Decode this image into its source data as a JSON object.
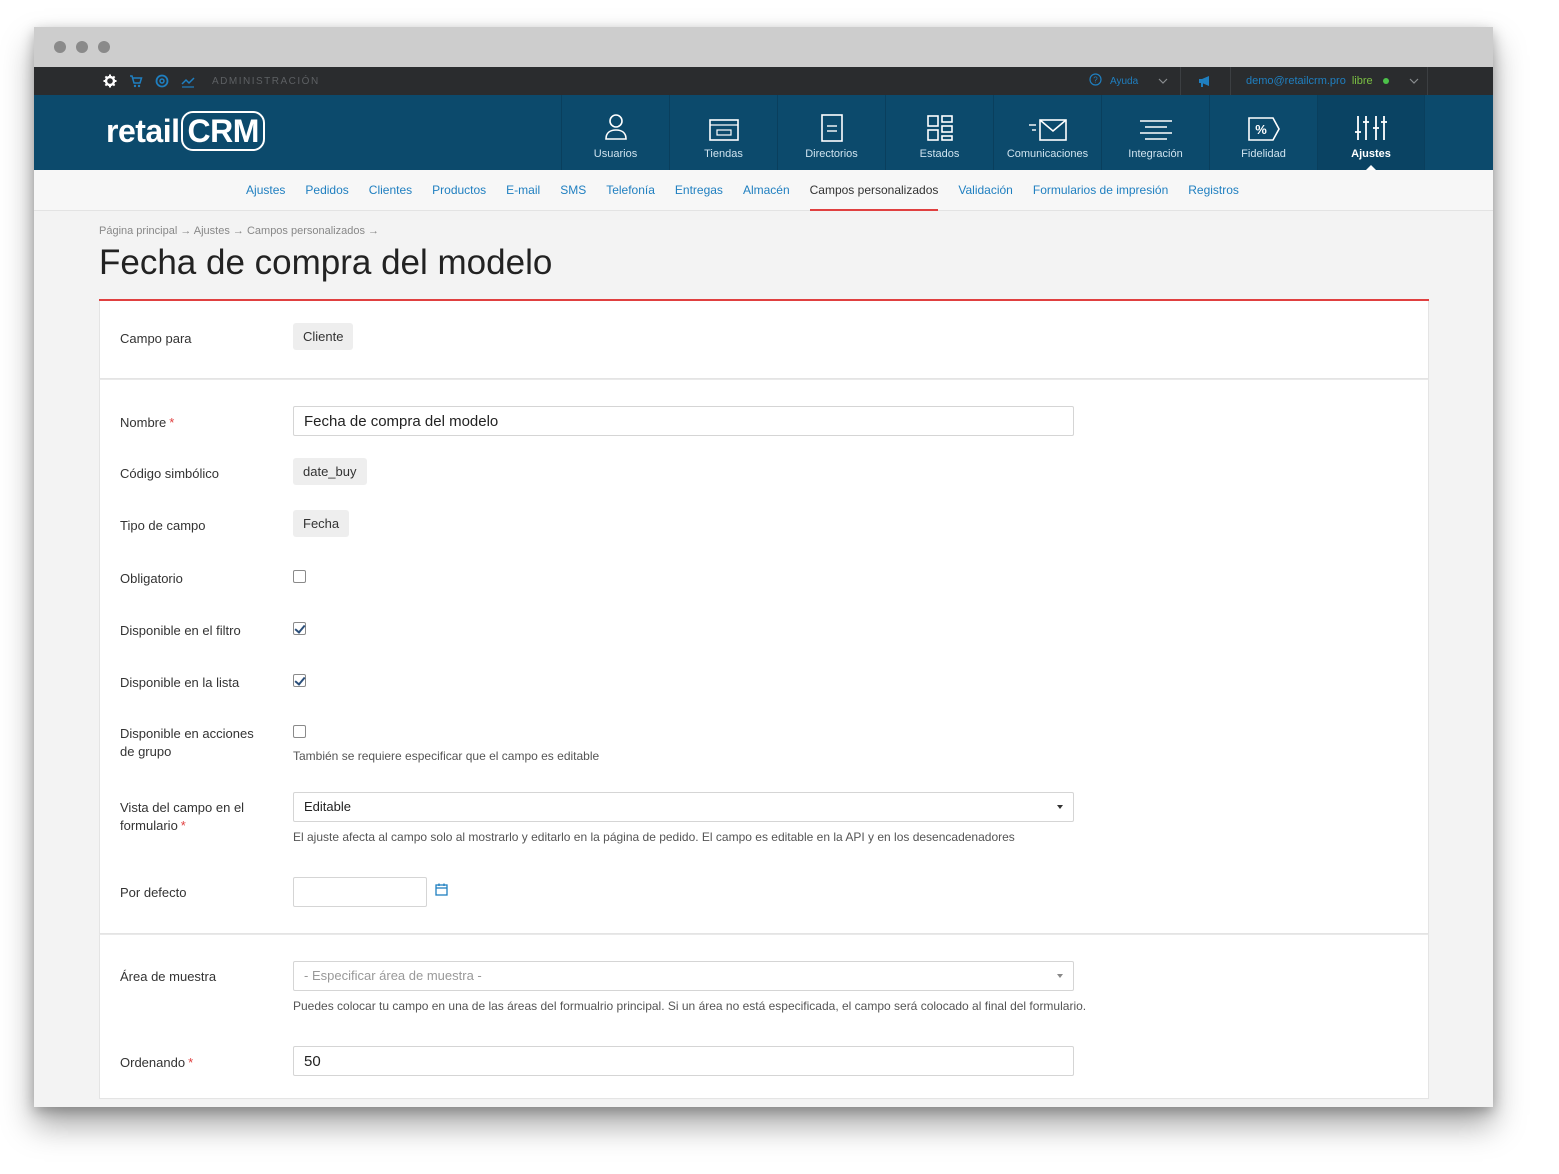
{
  "adminbar": {
    "admin_label": "ADMINISTRACIÓN",
    "help_label": "Ayuda",
    "user_email": "demo@retailcrm.pro",
    "user_plan": "libre"
  },
  "brand": {
    "name_prefix": "retail",
    "name_suffix": "CRM"
  },
  "nav": {
    "items": [
      {
        "label": "Usuarios",
        "icon": "user-icon"
      },
      {
        "label": "Tiendas",
        "icon": "store-icon"
      },
      {
        "label": "Directorios",
        "icon": "directory-icon"
      },
      {
        "label": "Estados",
        "icon": "statuses-icon"
      },
      {
        "label": "Comunicaciones",
        "icon": "mail-icon"
      },
      {
        "label": "Integración",
        "icon": "integration-icon"
      },
      {
        "label": "Fidelidad",
        "icon": "loyalty-icon"
      },
      {
        "label": "Ajustes",
        "icon": "settings-sliders-icon"
      }
    ],
    "active": "Ajustes"
  },
  "subnav": {
    "items": [
      "Ajustes",
      "Pedidos",
      "Clientes",
      "Productos",
      "E-mail",
      "SMS",
      "Telefonía",
      "Entregas",
      "Almacén",
      "Campos personalizados",
      "Validación",
      "Formularios de impresión",
      "Registros"
    ],
    "active": "Campos personalizados"
  },
  "breadcrumb": "Página principal → Ajustes → Campos personalizados →",
  "page_title": "Fecha de compra del modelo",
  "form": {
    "campo_para": {
      "label": "Campo para",
      "value": "Cliente"
    },
    "nombre": {
      "label": "Nombre",
      "value": "Fecha de compra del modelo"
    },
    "codigo": {
      "label": "Código simbólico",
      "value": "date_buy"
    },
    "tipo": {
      "label": "Tipo de campo",
      "value": "Fecha"
    },
    "obligatorio": {
      "label": "Obligatorio",
      "checked": false
    },
    "filtro": {
      "label": "Disponible en el filtro",
      "checked": true
    },
    "lista": {
      "label": "Disponible en la lista",
      "checked": true
    },
    "acciones_line1": "Disponible en acciones",
    "acciones_line2": "de grupo",
    "acciones_checked": false,
    "acciones_hint": "También se requiere especificar que el campo es editable",
    "vista_line1": "Vista del campo en el",
    "vista_line2": "formulario",
    "vista_value": "Editable",
    "vista_hint": "El ajuste afecta al campo solo al mostrarlo y editarlo en la página de pedido. El campo es editable en la API y en los desencadenadores",
    "defecto": {
      "label": "Por defecto",
      "value": ""
    },
    "area": {
      "label": "Área de muestra",
      "placeholder": "- Especificar área de muestra -",
      "hint": "Puedes colocar tu campo en una de las áreas del formualrio principal. Si un área no está especificada, el campo será colocado al final del formulario."
    },
    "ordenando": {
      "label": "Ordenando",
      "value": "50"
    }
  },
  "colors": {
    "nav_bg": "#0c4a6c",
    "accent": "#e04040",
    "link": "#1f7fc0"
  }
}
